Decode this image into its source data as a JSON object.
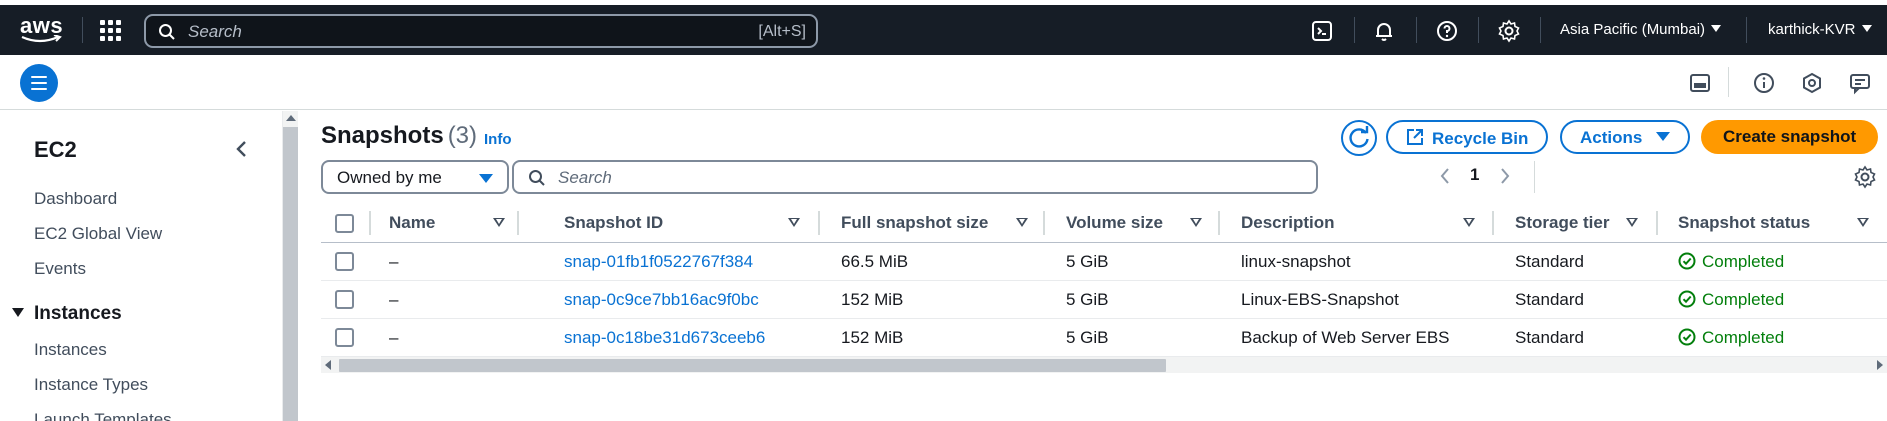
{
  "topbar": {
    "logo_text": "aws",
    "search_placeholder": "Search",
    "search_shortcut": "[Alt+S]",
    "region": "Asia Pacific (Mumbai)",
    "user": "karthick-KVR",
    "icons": [
      "cloudshell-icon",
      "bell-icon",
      "help-icon",
      "gear-icon"
    ]
  },
  "secondbar": {
    "icons": [
      "menu-icon",
      "panel-icon",
      "info-icon",
      "notifications-icon",
      "feedback-icon"
    ]
  },
  "sidebar": {
    "title": "EC2",
    "items_top": [
      "Dashboard",
      "EC2 Global View",
      "Events"
    ],
    "section": "Instances",
    "section_items": [
      "Instances",
      "Instance Types",
      "Launch Templates"
    ]
  },
  "main": {
    "title": "Snapshots",
    "count": "(3)",
    "info": "Info",
    "buttons": {
      "recycle_bin": "Recycle Bin",
      "actions": "Actions",
      "create": "Create snapshot"
    },
    "filter": "Owned by me",
    "search_placeholder": "Search",
    "page": "1"
  },
  "table": {
    "columns": [
      "Name",
      "Snapshot ID",
      "Full snapshot size",
      "Volume size",
      "Description",
      "Storage tier",
      "Snapshot status"
    ],
    "rows": [
      {
        "name": "–",
        "id": "snap-01fb1f0522767f384",
        "full_size": "66.5 MiB",
        "volume_size": "5 GiB",
        "description": "linux-snapshot",
        "tier": "Standard",
        "status": "Completed"
      },
      {
        "name": "–",
        "id": "snap-0c9ce7bb16ac9f0bc",
        "full_size": "152 MiB",
        "volume_size": "5 GiB",
        "description": "Linux-EBS-Snapshot",
        "tier": "Standard",
        "status": "Completed"
      },
      {
        "name": "–",
        "id": "snap-0c18be31d673ceeb6",
        "full_size": "152 MiB",
        "volume_size": "5 GiB",
        "description": "Backup of Web Server EBS",
        "tier": "Standard",
        "status": "Completed"
      }
    ]
  },
  "colors": {
    "topbar_bg": "#161d26",
    "link": "#0972d3",
    "primary_button": "#ff9900",
    "success": "#037f0c"
  }
}
